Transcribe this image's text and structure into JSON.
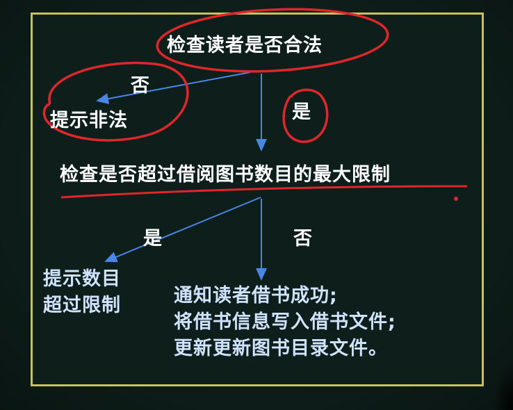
{
  "diagram": {
    "check_reader": "检查读者是否合法",
    "no_label_1": "否",
    "illegal_prompt": "提示非法",
    "yes_label_1": "是",
    "check_limit": "检查是否超过借阅图书数目的最大限制",
    "yes_label_2": "是",
    "no_label_2": "否",
    "over_limit_line1": "提示数目",
    "over_limit_line2": "超过限制",
    "success_line1": "通知读者借书成功;",
    "success_line2": "将借书信息写入借书文件;",
    "success_line3": "更新更新图书目录文件。"
  },
  "colors": {
    "board": "#0e1f1b",
    "frame": "#c9c25a",
    "arrow": "#4a86e8",
    "annotation": "#e0262b",
    "text": "#ffffff"
  }
}
